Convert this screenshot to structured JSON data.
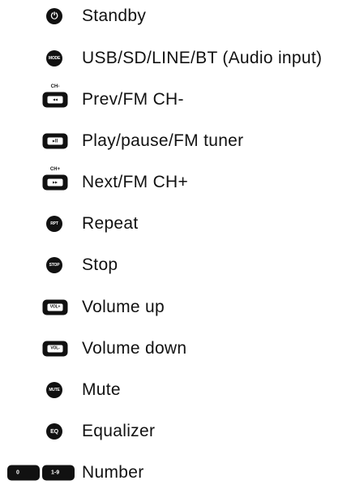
{
  "legend": {
    "items": [
      {
        "label": "Standby",
        "icon": "power-icon",
        "icon_text": "⏻"
      },
      {
        "label": "USB/SD/LINE/BT (Audio input)",
        "icon": "mode-icon",
        "icon_text": "MODE"
      },
      {
        "label": "Prev/FM CH-",
        "icon": "prev-icon",
        "icon_text": "◂◂",
        "tag": "CH-"
      },
      {
        "label": "Play/pause/FM tuner",
        "icon": "play-pause-icon",
        "icon_text": "▸ll"
      },
      {
        "label": "Next/FM CH+",
        "icon": "next-icon",
        "icon_text": "▸▸",
        "tag": "CH+"
      },
      {
        "label": "Repeat",
        "icon": "repeat-icon",
        "icon_text": "RPT"
      },
      {
        "label": "Stop",
        "icon": "stop-icon",
        "icon_text": "STOP"
      },
      {
        "label": "Volume up",
        "icon": "volume-up-icon",
        "icon_text": "VOL+"
      },
      {
        "label": "Volume down",
        "icon": "volume-down-icon",
        "icon_text": "VOL-"
      },
      {
        "label": "Mute",
        "icon": "mute-icon",
        "icon_text": "MUTE"
      },
      {
        "label": "Equalizer",
        "icon": "equalizer-icon",
        "icon_text": "EQ"
      },
      {
        "label": "Number",
        "icon": "number-keys-icon",
        "keys": [
          "0",
          "1-9"
        ]
      }
    ]
  }
}
